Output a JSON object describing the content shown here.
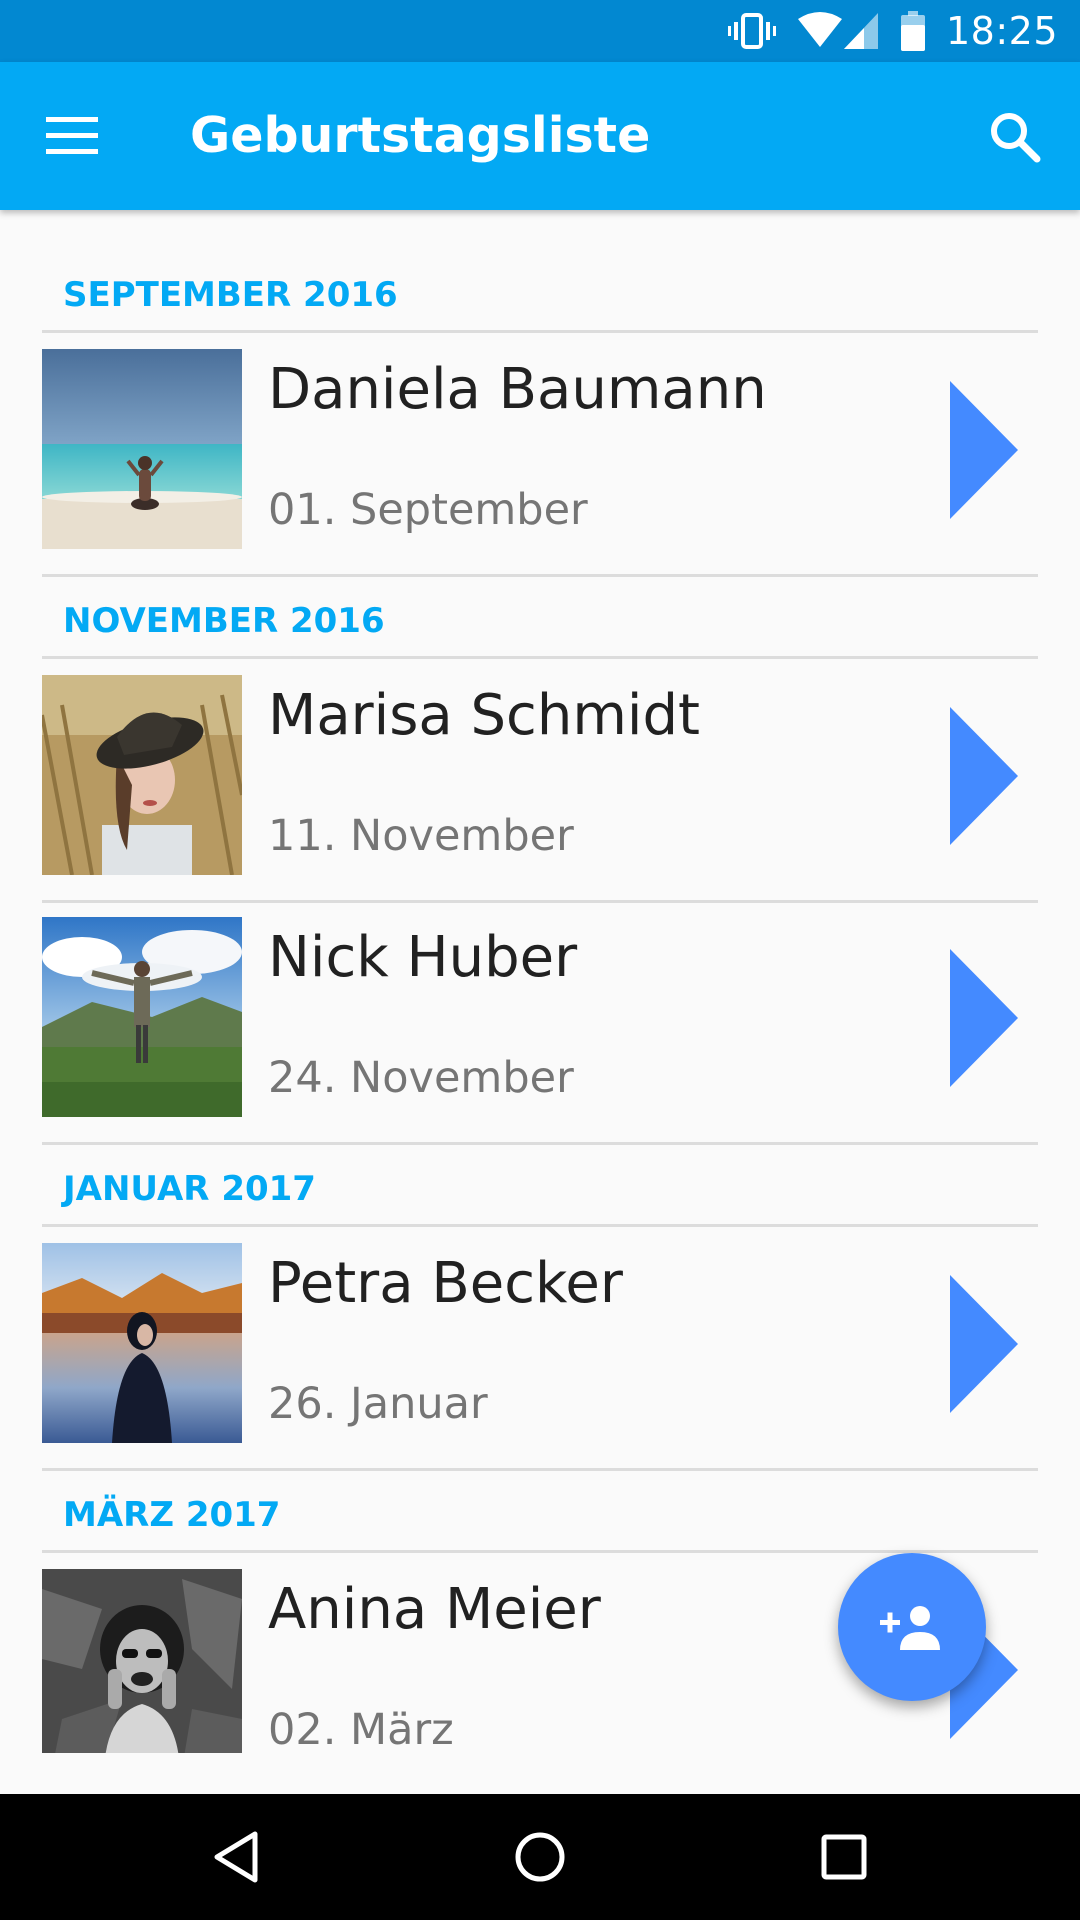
{
  "status_bar": {
    "time": "18:25",
    "icons": [
      "vibrate-icon",
      "wifi-icon",
      "signal-icon",
      "battery-icon"
    ]
  },
  "app_bar": {
    "title": "Geburtstagsliste",
    "menu_icon": "menu-icon",
    "search_icon": "search-icon",
    "color": "#03a9f4"
  },
  "list": {
    "sections": [
      {
        "header": "SEPTEMBER 2016",
        "entries": [
          {
            "name": "Daniela Baumann",
            "date": "01. September",
            "photo": "beach-photo"
          }
        ]
      },
      {
        "header": "NOVEMBER 2016",
        "entries": [
          {
            "name": "Marisa Schmidt",
            "date": "11. November",
            "photo": "woman-hat-photo"
          },
          {
            "name": "Nick Huber",
            "date": "24. November",
            "photo": "mountain-photo"
          }
        ]
      },
      {
        "header": "JANUAR 2017",
        "entries": [
          {
            "name": "Petra Becker",
            "date": "26. Januar",
            "photo": "lake-photo"
          }
        ]
      },
      {
        "header": "MÄRZ 2017",
        "entries": [
          {
            "name": "Anina Meier",
            "date": "02. März",
            "photo": "bw-portrait-photo"
          }
        ]
      }
    ],
    "accent_color": "#03a9f4",
    "chevron_color": "#448aff"
  },
  "fab": {
    "icon": "add-person-icon",
    "color": "#448aff"
  },
  "nav_bar": {
    "icons": [
      "back-icon",
      "home-icon",
      "recents-icon"
    ]
  }
}
